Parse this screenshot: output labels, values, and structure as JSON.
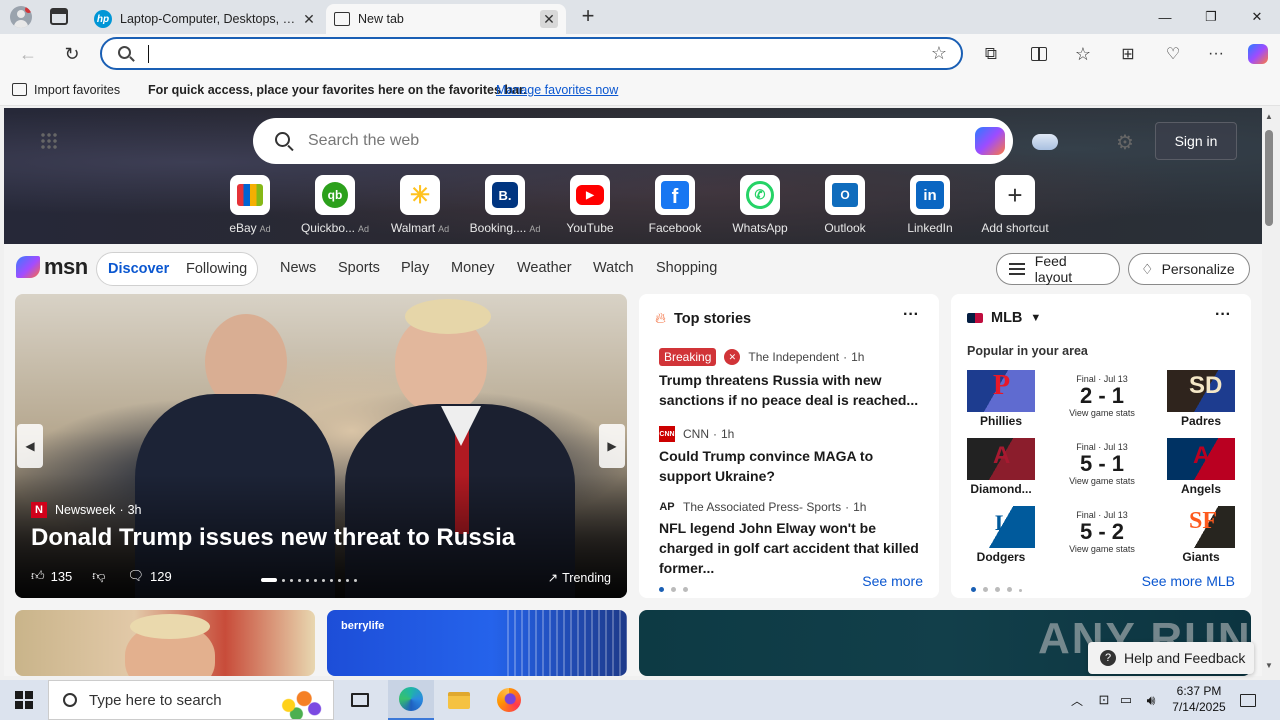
{
  "browser": {
    "tabs": [
      {
        "title": "Laptop-Computer, Desktops, Dru",
        "icon": "hp-logo-icon"
      },
      {
        "title": "New tab",
        "icon": "new-tab-page-icon"
      }
    ],
    "address_value": "",
    "favorites_bar": {
      "import_label": "Import favorites",
      "message": "For quick access, place your favorites here on the favorites bar.",
      "manage_link": "Manage favorites now"
    }
  },
  "msn": {
    "search_placeholder": "Search the web",
    "sign_in": "Sign in",
    "shortcuts": [
      {
        "label": "eBay",
        "ad": "Ad",
        "color": "#ffffff"
      },
      {
        "label": "Quickbo...",
        "ad": "Ad",
        "color": "#2ca01c"
      },
      {
        "label": "Walmart",
        "ad": "Ad",
        "color": "#0071dc"
      },
      {
        "label": "Booking....",
        "ad": "Ad",
        "color": "#003580"
      },
      {
        "label": "YouTube",
        "ad": "",
        "color": "#ff0000"
      },
      {
        "label": "Facebook",
        "ad": "",
        "color": "#1877f2"
      },
      {
        "label": "WhatsApp",
        "ad": "",
        "color": "#25d366"
      },
      {
        "label": "Outlook",
        "ad": "",
        "color": "#0f6cbd"
      },
      {
        "label": "LinkedIn",
        "ad": "",
        "color": "#0a66c2"
      },
      {
        "label": "Add shortcut",
        "ad": "",
        "color": "#ffffff"
      }
    ],
    "brand": "msn",
    "nav": {
      "discover": "Discover",
      "following": "Following",
      "links": [
        "News",
        "Sports",
        "Play",
        "Money",
        "Weather",
        "Watch",
        "Shopping"
      ],
      "feed_layout": "Feed layout",
      "personalize": "Personalize"
    },
    "hero": {
      "source": "Newsweek",
      "time": "3h",
      "headline": "Donald Trump issues new threat to Russia",
      "likes": "135",
      "comments": "129",
      "trending": "Trending"
    },
    "top_stories": {
      "title": "Top stories",
      "stories": [
        {
          "badge": "Breaking",
          "source": "The Independent",
          "time": "1h",
          "headline": "Trump threatens Russia with new sanctions if no peace deal is reached..."
        },
        {
          "badge": "",
          "source": "CNN",
          "time": "1h",
          "headline": "Could Trump convince MAGA to support Ukraine?"
        },
        {
          "badge": "",
          "source": "The Associated Press- Sports",
          "time": "1h",
          "headline": "NFL legend John Elway won't be charged in golf cart accident that killed former..."
        }
      ],
      "see_more": "See more"
    },
    "mlb": {
      "title": "MLB",
      "subtitle": "Popular in your area",
      "games": [
        {
          "status": "Final · Jul 13",
          "team1": "Phillies",
          "team2": "Padres",
          "score": "2 - 1",
          "link": "View game stats",
          "c1": "#1d3c8f",
          "c2": "#2f241d"
        },
        {
          "status": "Final · Jul 13",
          "team1": "Diamond...",
          "team2": "Angels",
          "score": "5 - 1",
          "link": "View game stats",
          "c1": "#a71930",
          "c2": "#003263"
        },
        {
          "status": "Final · Jul 13",
          "team1": "Dodgers",
          "team2": "Giants",
          "score": "5 - 2",
          "link": "View game stats",
          "c1": "#005a9c",
          "c2": "#fd5a1e"
        }
      ],
      "see_more": "See more MLB"
    },
    "promo": {
      "brand": "berrylife"
    },
    "help": "Help and Feedback",
    "watermark": "ANY RUN"
  },
  "taskbar": {
    "search_placeholder": "Type here to search",
    "time": "6:37 PM",
    "date": "7/14/2025"
  }
}
